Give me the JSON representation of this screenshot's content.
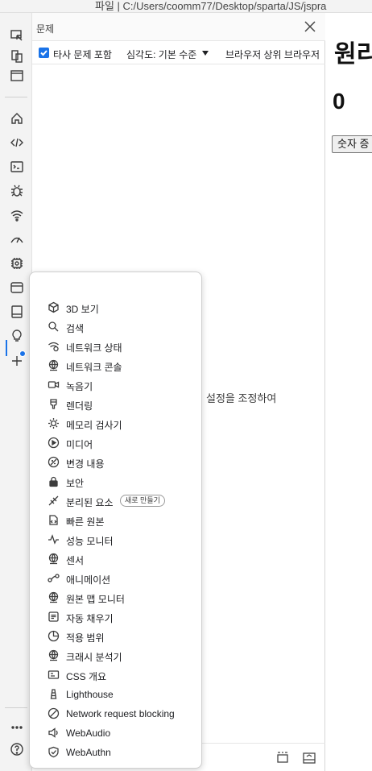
{
  "address_bar": {
    "text": "파일  |  C:/Users/coomm77/Desktop/sparta/JS/jspra"
  },
  "issues_panel": {
    "title": "문제",
    "include_third_party_label": "타사 문제 포함",
    "severity_label": "심각도: 기본 수준",
    "browser_filter_label": "브라우저 상위 브라우저",
    "message_fragment": "설정을 조정하여"
  },
  "page": {
    "heading": "원리",
    "counter_value": "0",
    "button_label": "숫자 증"
  },
  "more_tools_menu": {
    "items": [
      {
        "label": "3D 보기",
        "icon": "cube-icon"
      },
      {
        "label": "검색",
        "icon": "search-icon"
      },
      {
        "label": "네트워크 상태",
        "icon": "network-conditions-icon"
      },
      {
        "label": "네트워크 콘솔",
        "icon": "globe-icon"
      },
      {
        "label": "녹음기",
        "icon": "recorder-icon"
      },
      {
        "label": "렌더링",
        "icon": "rendering-icon"
      },
      {
        "label": "메모리 검사기",
        "icon": "memory-inspector-icon"
      },
      {
        "label": "미디어",
        "icon": "media-play-icon"
      },
      {
        "label": "변경 내용",
        "icon": "changes-icon"
      },
      {
        "label": "보안",
        "icon": "lock-icon"
      },
      {
        "label": "분리된 요소",
        "icon": "detached-elements-icon",
        "badge": "새로 만들기"
      },
      {
        "label": "빠른 원본",
        "icon": "quick-source-icon"
      },
      {
        "label": "성능 모니터",
        "icon": "performance-monitor-icon"
      },
      {
        "label": "센서",
        "icon": "globe-icon"
      },
      {
        "label": "애니메이션",
        "icon": "animation-icon"
      },
      {
        "label": "원본 맵 모니터",
        "icon": "globe-icon"
      },
      {
        "label": "자동 채우기",
        "icon": "autofill-icon"
      },
      {
        "label": "적용 범위",
        "icon": "coverage-icon"
      },
      {
        "label": "크래시 분석기",
        "icon": "globe-icon"
      },
      {
        "label": "CSS 개요",
        "icon": "css-overview-icon"
      },
      {
        "label": "Lighthouse",
        "icon": "lighthouse-icon"
      },
      {
        "label": "Network request blocking",
        "icon": "block-icon"
      },
      {
        "label": "WebAudio",
        "icon": "speaker-icon"
      },
      {
        "label": "WebAuthn",
        "icon": "shield-icon"
      }
    ]
  },
  "colors": {
    "accent": "#1a73e8"
  }
}
